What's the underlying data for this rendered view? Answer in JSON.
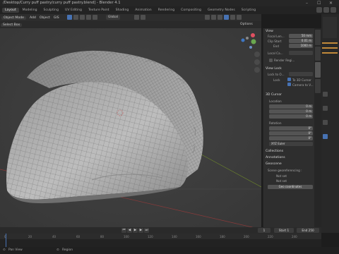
{
  "title": "/Desktop/Curry puff pastry/curry puff pastry.blend] - Blender 4.1",
  "window_controls": {
    "minimize": "–",
    "maximize": "☐",
    "close": "✕"
  },
  "tabs": [
    "Layout",
    "Modeling",
    "Sculpting",
    "UV Editing",
    "Texture Paint",
    "Shading",
    "Animation",
    "Rendering",
    "Compositing",
    "Geometry Nodes",
    "Scripting"
  ],
  "header": {
    "menus": [
      "Add",
      "Object",
      "GIS"
    ],
    "mode": "Object Mode",
    "pivot": "Global",
    "options": "Options"
  },
  "header2": {
    "select": "Select Box"
  },
  "npanel": {
    "view_section": "View",
    "focal_label": "Focal Len...",
    "focal_value": "50 mm",
    "clip_start_label": "Clip Start",
    "clip_start_value": "0.01 m",
    "clip_end_label": "End",
    "clip_end_value": "1000 m",
    "local_camera_label": "Local Ca...",
    "render_region_label": "Render Regi...",
    "view_lock_section": "View Lock",
    "lock_to_obj_label": "Lock to O...",
    "lock_label": "Lock",
    "lock_3d_cursor": "To 3D Cursor",
    "lock_camera": "Camera to V...",
    "cursor_section": "3D Cursor",
    "location_label": "Location",
    "loc_x": "0 m",
    "loc_y": "0 m",
    "loc_z": "0 m",
    "rotation_label": "Rotation",
    "rot_x": "0°",
    "rot_y": "0°",
    "rot_z": "0°",
    "rotation_mode": "XYZ Euler",
    "collections_section": "Collections",
    "annotations_section": "Annotations",
    "geoscene_section": "Geoscene",
    "geoscene_info": "Scene georeferencing :",
    "geoscene_x": "Not set",
    "geoscene_y": "Not set",
    "geoscene_button": "Geo coordinates"
  },
  "timeline": {
    "ticks": [
      "0",
      "20",
      "40",
      "60",
      "80",
      "100",
      "120",
      "140",
      "160",
      "180",
      "200",
      "220",
      "240"
    ],
    "current_frame": "1",
    "start_label": "Start",
    "start": "1",
    "end_label": "End",
    "end": "250"
  },
  "statusbar": {
    "pan_view": "Pan View",
    "region": "Region"
  },
  "colors": {
    "accent": "#4772b3",
    "viewport": "#3d3d3d",
    "grid_x": "#8a3a3a",
    "grid_y": "#6f8a2a",
    "active_tab": "#3d3d3d"
  }
}
